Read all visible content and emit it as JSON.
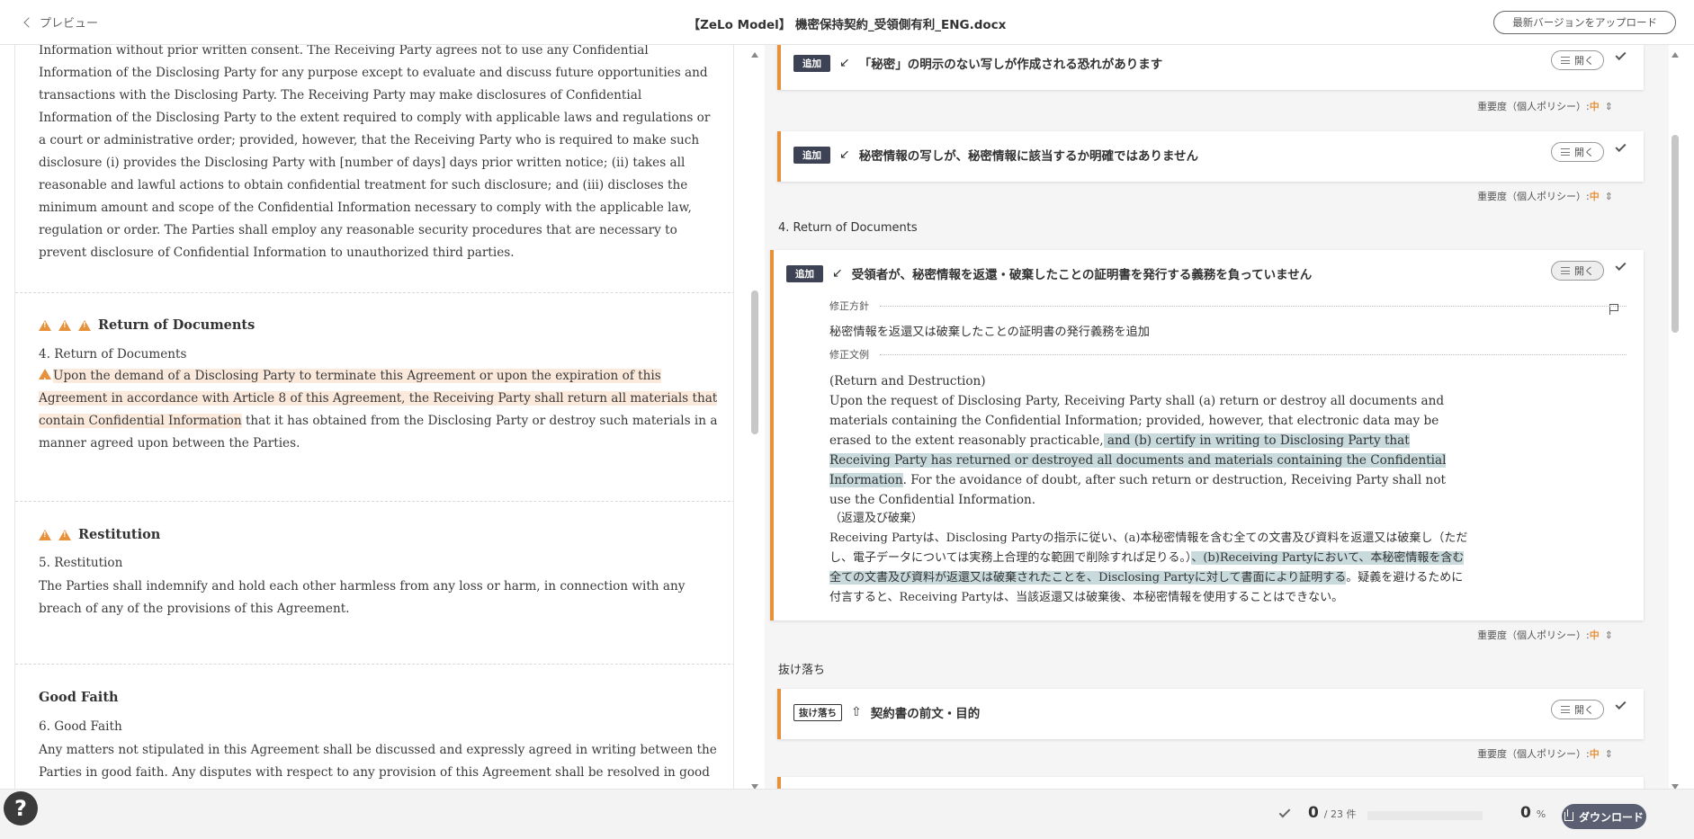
{
  "header": {
    "back_label": "プレビュー",
    "title": "【ZeLo Model】 機密保持契約_受領側有利_ENG.docx",
    "upload_label": "最新バージョンをアップロード"
  },
  "left": {
    "intro_text": "Information without prior written consent. The Receiving Party agrees not to use any Confidential Information of the Disclosing Party for any purpose except to evaluate and discuss future opportunities and transactions with the Disclosing Party. The Receiving Party may make disclosures of Confidential Information of the Disclosing Party to the extent required to comply with applicable laws and regulations or a court or administrative order; provided, however, that the Receiving Party who is required to make such disclosure (i) provides the Disclosing Party with [number of days] days  prior written notice; (ii) takes all reasonable and lawful actions to obtain confidential treatment for such disclosure; and (iii) discloses the minimum amount and scope of the Confidential Information necessary to comply with the applicable law, regulation or order. The Parties shall employ any reasonable security procedures that are necessary to prevent disclosure of Confidential Information to unauthorized third parties.",
    "sections": [
      {
        "heading": "Return of Documents",
        "sub": "4. Return of Documents",
        "highlight": "Upon the demand of a Disclosing Party to terminate this Agreement or upon the expiration of this Agreement in accordance with Article 8 of this Agreement, the Receiving Party shall return all materials that contain Confidential Information",
        "rest": " that it has obtained from the Disclosing Party or destroy such materials in a manner agreed upon between the Parties."
      },
      {
        "heading": "Restitution",
        "sub": "5. Restitution",
        "body": "The Parties shall indemnify and hold each other harmless from any loss or harm, in connection with any breach of any of the provisions of this Agreement."
      },
      {
        "heading": "Good Faith",
        "sub": "6. Good Faith",
        "body": "Any matters not stipulated in this Agreement shall be discussed and expressly agreed in writing between the Parties in good faith. Any disputes with respect to any provision of this Agreement shall be resolved in good faith."
      }
    ]
  },
  "right": {
    "open_label": "開く",
    "severity_prefix": "重要度（個人ポリシー）:",
    "severity_value": "中",
    "cards": [
      {
        "badge": "追加",
        "title": "「秘密」の明示のない写しが作成される恐れがあります"
      },
      {
        "badge": "追加",
        "title": "秘密情報の写しが、秘密情報に該当するか明確ではありません"
      },
      {
        "badge": "追加",
        "title": "受領者が、秘密情報を返還・破棄したことの証明書を発行する義務を負っていません"
      },
      {
        "badge": "抜け落ち",
        "title": "契約書の前文・目的"
      }
    ],
    "group_return": "4. Return of Documents",
    "group_missing": "抜け落ち",
    "detail": {
      "policy_label": "修正方針",
      "policy_text": "秘密情報を返還又は破棄したことの証明書の発行義務を追加",
      "example_label": "修正文例",
      "en_title": "(Return and Destruction)",
      "en_before": "Upon the request of Disclosing Party, Receiving Party shall (a) return or destroy all documents and materials containing the Confidential Information; provided, however, that electronic data may be erased to the extent reasonably practicable,",
      "en_hl": " and (b) certify in writing to Disclosing Party that Receiving Party has returned or destroyed all documents and materials containing the Confidential Information",
      "en_after": ". For the avoidance of doubt, after such return or destruction, Receiving Party shall not use the Confidential Information.",
      "jp_title": "（返還及び破棄）",
      "jp_before": "Receiving Partyは、Disclosing Partyの指示に従い、(a)本秘密情報を含む全ての文書及び資料を返還又は破棄し（ただし、電子データについては実務上合理的な範囲で削除すれば足りる。）",
      "jp_hl": "、(b)Receiving Partyにおいて、本秘密情報を含む全ての文書及び資料が返還又は破棄されたことを、Disclosing Partyに対して書面により証明する",
      "jp_after": "。疑義を避けるために付言すると、Receiving Partyは、当該返還又は破棄後、本秘密情報を使用することはできない。"
    }
  },
  "footer": {
    "help": "?",
    "done_count": "0",
    "total": "/ 23 件",
    "progress": 0,
    "percent": "0",
    "percent_unit": "%",
    "download_label": "ダウンロード"
  },
  "colors": {
    "accent": "#e8913b",
    "badge": "#3d4354",
    "highlight_left": "#fbe9dc",
    "highlight_right": "#c9dadd"
  }
}
